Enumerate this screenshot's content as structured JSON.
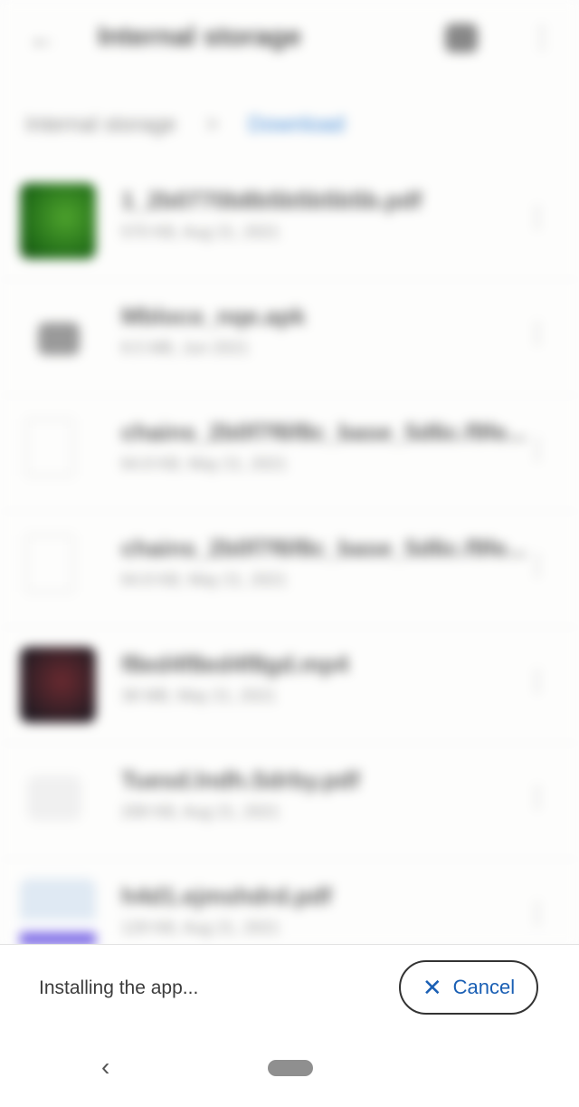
{
  "app_bar": {
    "back_icon": "arrow-back-icon",
    "title": "Internal storage",
    "view_icon": "grid-view-icon",
    "more_icon": "more-vert-icon"
  },
  "breadcrumb": {
    "root": "Internal storage",
    "separator": ">",
    "current": "Download"
  },
  "files": [
    {
      "name": "1_2b0770b8b5b5b5b5b.pdf",
      "meta": "570 KB, Aug 21, 2021",
      "thumb": "green"
    },
    {
      "name": "Mbloco_nqe.apk",
      "meta": "8.5 MB, Jun 2021",
      "thumb": "folder"
    },
    {
      "name": "chains_2b0f7f6f8c_base_5d6c.f9fe...",
      "meta": "64.8 KB, May 21, 2021",
      "thumb": "doc"
    },
    {
      "name": "chains_2b0f7f6f8c_base_5d6c.f9fe...",
      "meta": "64.8 KB, May 21, 2021",
      "thumb": "doc"
    },
    {
      "name": "f8ed4f8ed4f8gd.mp4",
      "meta": "38 MB, May 21, 2021",
      "thumb": "dark"
    },
    {
      "name": "Tuesd.lndh.Sdrby.pdf",
      "meta": "208 KB, Aug 21, 2021",
      "thumb": "light"
    },
    {
      "name": "h4d1.ejmshdrd.pdf",
      "meta": "129 KB, Aug 21, 2021",
      "thumb": "app"
    }
  ],
  "snackbar": {
    "message": "Installing the app...",
    "cancel_label": "Cancel",
    "cancel_icon": "close-icon"
  },
  "nav": {
    "back_icon": "chevron-left-icon",
    "home_icon": "home-pill-icon"
  }
}
